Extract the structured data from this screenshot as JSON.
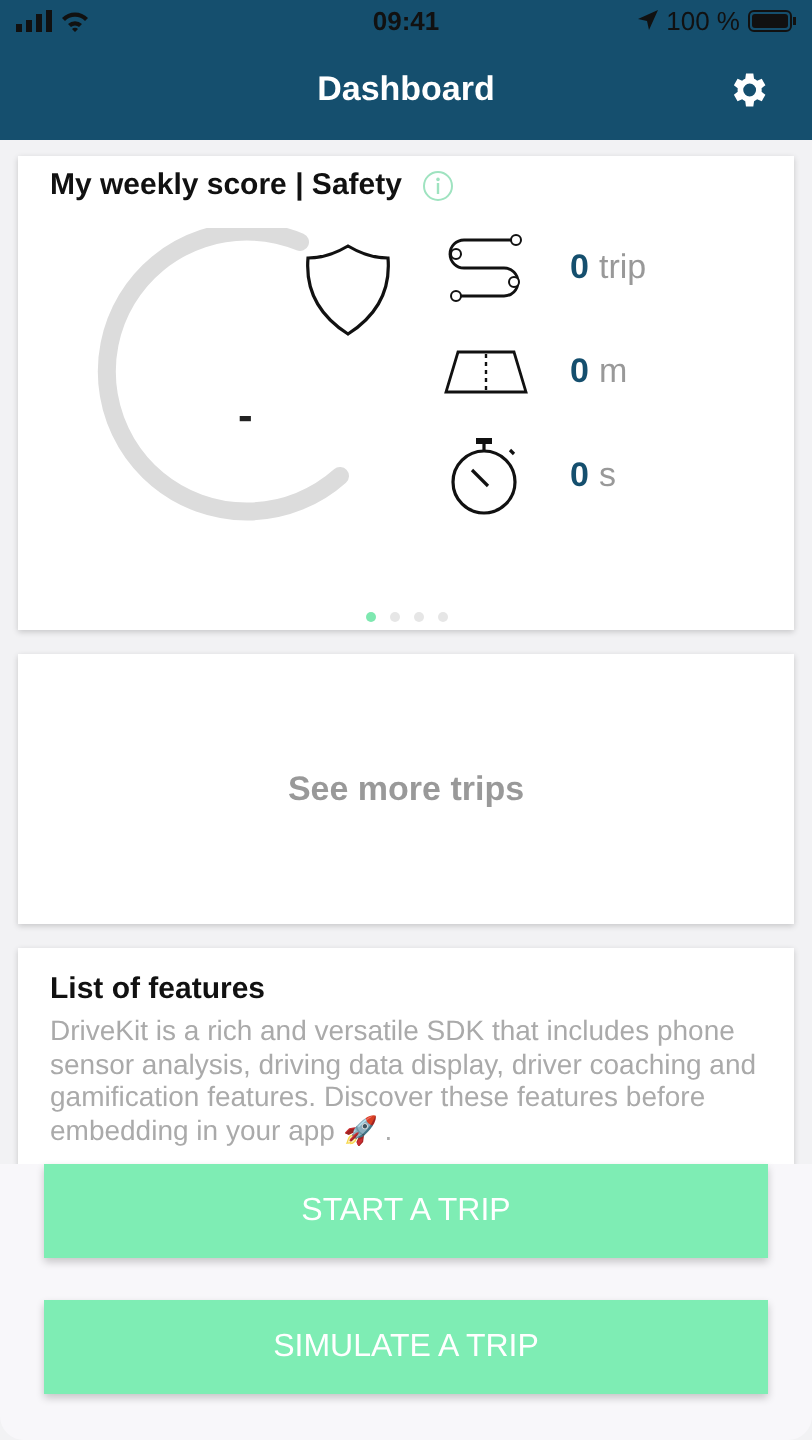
{
  "status_bar": {
    "time": "09:41",
    "battery": "100 %"
  },
  "header": {
    "title": "Dashboard"
  },
  "score_card": {
    "title": "My weekly score | Safety",
    "score": "-",
    "stats": [
      {
        "kind": "trips",
        "value": "0",
        "unit": "trip"
      },
      {
        "kind": "distance",
        "value": "0",
        "unit": "m"
      },
      {
        "kind": "duration",
        "value": "0",
        "unit": "s"
      }
    ],
    "pages": [
      {
        "selected": true
      },
      {
        "selected": false
      },
      {
        "selected": false
      },
      {
        "selected": false
      }
    ]
  },
  "trips_card": {
    "label": "See more trips"
  },
  "features_card": {
    "title": "List of features",
    "text": "DriveKit is a rich and versatile SDK that includes phone sensor analysis, driving data display, driver coaching and gamification features. Discover these features before embedding in your app 🚀 ."
  },
  "buttons": [
    "START A TRIP",
    "SIMULATE A TRIP"
  ]
}
